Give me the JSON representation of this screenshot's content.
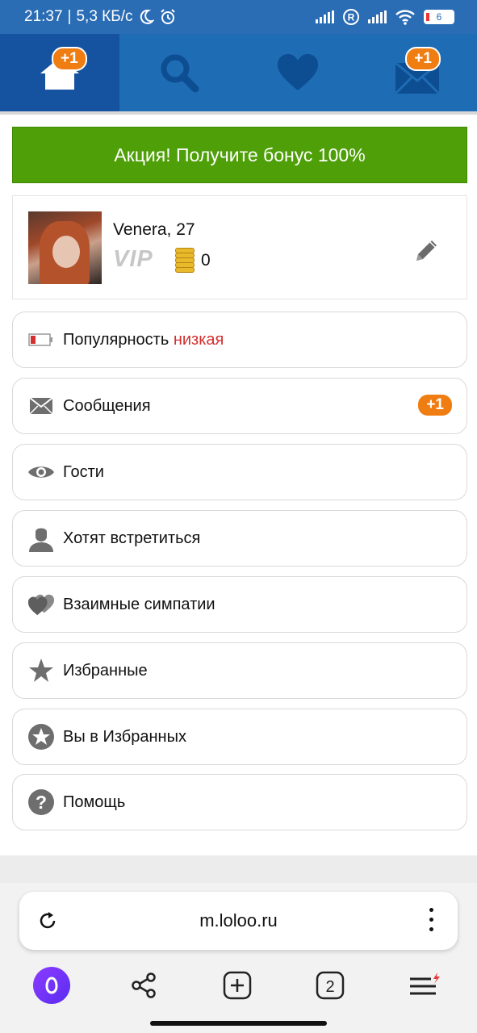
{
  "status_bar": {
    "time": "21:37",
    "speed": "5,3 КБ/с",
    "roaming": "R",
    "battery": "6"
  },
  "nav": {
    "home_badge": "+1",
    "messages_badge": "+1"
  },
  "promo": {
    "text": "Акция! Получите бонус 100%"
  },
  "profile": {
    "name_age": "Venera, 27",
    "vip_label": "VIP",
    "coins": "0"
  },
  "menu": {
    "popularity": {
      "label": "Популярность",
      "value": "низкая"
    },
    "messages": {
      "label": "Сообщения",
      "badge": "+1"
    },
    "guests": {
      "label": "Гости"
    },
    "want_meet": {
      "label": "Хотят встретиться"
    },
    "mutual": {
      "label": "Взаимные симпатии"
    },
    "favorites": {
      "label": "Избранные"
    },
    "in_favorites": {
      "label": "Вы в Избранных"
    },
    "help": {
      "label": "Помощь"
    }
  },
  "browser": {
    "url": "m.loloo.ru",
    "tabs_count": "2"
  },
  "colors": {
    "nav_bg": "#1e6cb4",
    "nav_active": "#1553a0",
    "badge": "#ef7d12",
    "promo": "#4e9f08",
    "popularity_low": "#d32f2f"
  }
}
